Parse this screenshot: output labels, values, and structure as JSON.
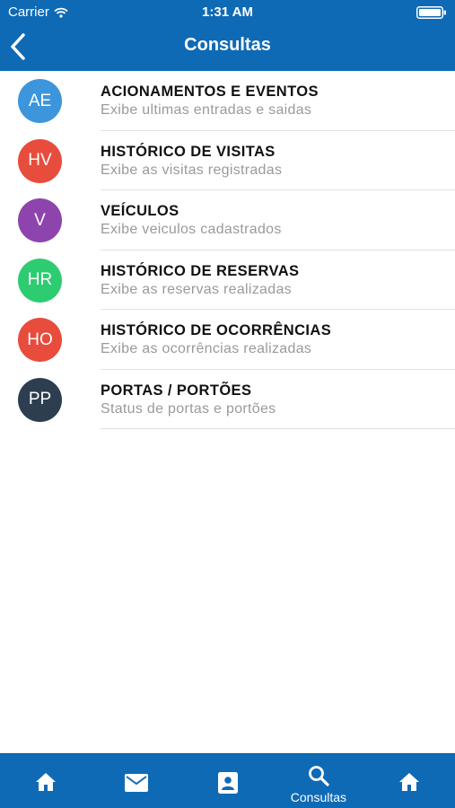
{
  "status_bar": {
    "carrier": "Carrier",
    "time": "1:31 AM"
  },
  "nav": {
    "title": "Consultas"
  },
  "items": [
    {
      "initials": "AE",
      "title": "ACIONAMENTOS E EVENTOS",
      "subtitle": "Exibe ultimas entradas e saidas",
      "color": "#3d95dc"
    },
    {
      "initials": "HV",
      "title": "HISTÓRICO DE VISITAS",
      "subtitle": "Exibe as visitas registradas",
      "color": "#e74c3c"
    },
    {
      "initials": "V",
      "title": "VEÍCULOS",
      "subtitle": "Exibe veiculos cadastrados",
      "color": "#8e44ad"
    },
    {
      "initials": "HR",
      "title": "HISTÓRICO DE RESERVAS",
      "subtitle": "Exibe as reservas realizadas",
      "color": "#2ecc71"
    },
    {
      "initials": "HO",
      "title": "HISTÓRICO DE OCORRÊNCIAS",
      "subtitle": "Exibe as ocorrências realizadas",
      "color": "#e74c3c"
    },
    {
      "initials": "PP",
      "title": "PORTAS / PORTÕES",
      "subtitle": "Status de portas e portões",
      "color": "#2c3e50"
    }
  ],
  "tabbar": {
    "tabs": [
      {
        "icon": "home-icon",
        "label": ""
      },
      {
        "icon": "mail-icon",
        "label": ""
      },
      {
        "icon": "contact-card-icon",
        "label": ""
      },
      {
        "icon": "search-icon",
        "label": "Consultas"
      },
      {
        "icon": "home-icon",
        "label": ""
      }
    ]
  },
  "colors": {
    "primary": "#0f6ab5",
    "separator": "#e1e1e1",
    "subtitle": "#9a9a9a"
  }
}
